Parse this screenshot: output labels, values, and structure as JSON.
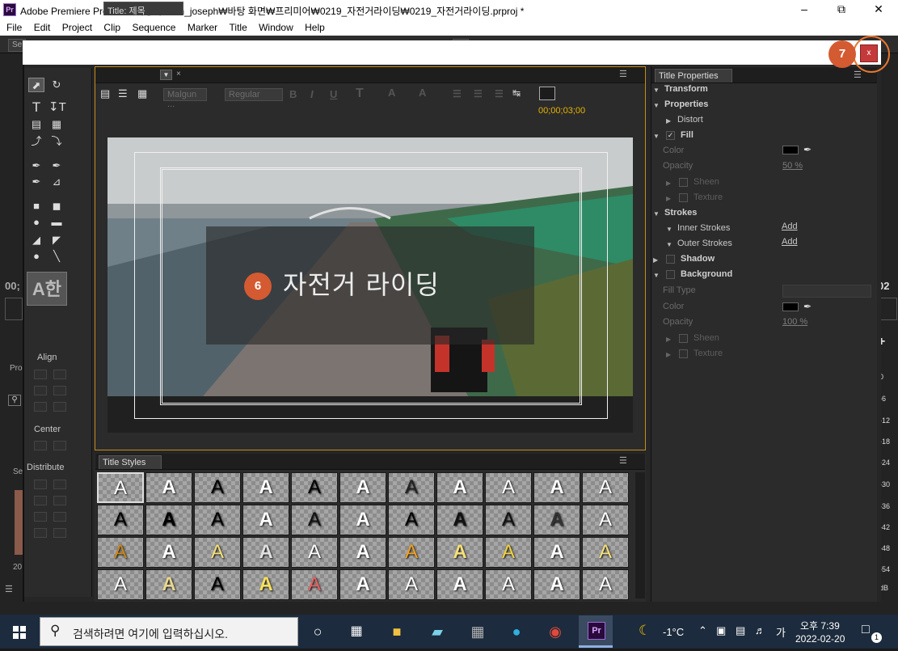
{
  "window": {
    "title": "Adobe Premiere Pro - C:₩사용자₩vm_joseph₩바탕 화면₩프리미어₩0219_자전거라이딩₩0219_자전거라이딩.prproj *",
    "app_icon": "Pr"
  },
  "menu": [
    "File",
    "Edit",
    "Project",
    "Clip",
    "Sequence",
    "Marker",
    "Title",
    "Window",
    "Help"
  ],
  "background": {
    "left_tab": "Se",
    "time_left": "00;",
    "time_right": "02",
    "side_label_pro": "Pro",
    "side_label_se": "Se",
    "side_year": "20",
    "ruler": [
      "0",
      "-6",
      "-12",
      "-18",
      "-24",
      "-30",
      "-36",
      "-42",
      "-48",
      "-54",
      "dB"
    ]
  },
  "dialog": {
    "close_label": "x",
    "badge_close": "7",
    "badge_text": "6"
  },
  "tools": {
    "sample": "A한",
    "align_label": "Align",
    "center_label": "Center",
    "distribute_label": "Distribute"
  },
  "title_panel": {
    "tab": "Title: 제목",
    "font_family": "Malgun ...",
    "font_style": "Regular",
    "timecode": "00;00;03;00",
    "text": "자전거 라이딩"
  },
  "styles_panel": {
    "tab": "Title Styles"
  },
  "props_panel": {
    "tab": "Title Properties",
    "transform": "Transform",
    "properties": "Properties",
    "distort": "Distort",
    "fill": "Fill",
    "color": "Color",
    "opacity": "Opacity",
    "opacity_value": "50 %",
    "sheen": "Sheen",
    "texture": "Texture",
    "strokes": "Strokes",
    "inner_strokes": "Inner Strokes",
    "outer_strokes": "Outer Strokes",
    "add": "Add",
    "shadow": "Shadow",
    "background": "Background",
    "fill_type": "Fill Type",
    "bg_color": "Color",
    "bg_opacity": "Opacity",
    "bg_opacity_value": "100 %",
    "bg_sheen": "Sheen",
    "bg_texture": "Texture"
  },
  "taskbar": {
    "search_placeholder": "검색하려면 여기에 입력하십시오.",
    "weather": "-1°C",
    "ime": "가",
    "time": "오후 7:39",
    "date": "2022-02-20",
    "notifications": "1"
  },
  "colors": {
    "accent_orange": "#e8772e",
    "badge": "#d45a32",
    "panel_border": "#c58c1a",
    "timecode": "#e6b400"
  }
}
